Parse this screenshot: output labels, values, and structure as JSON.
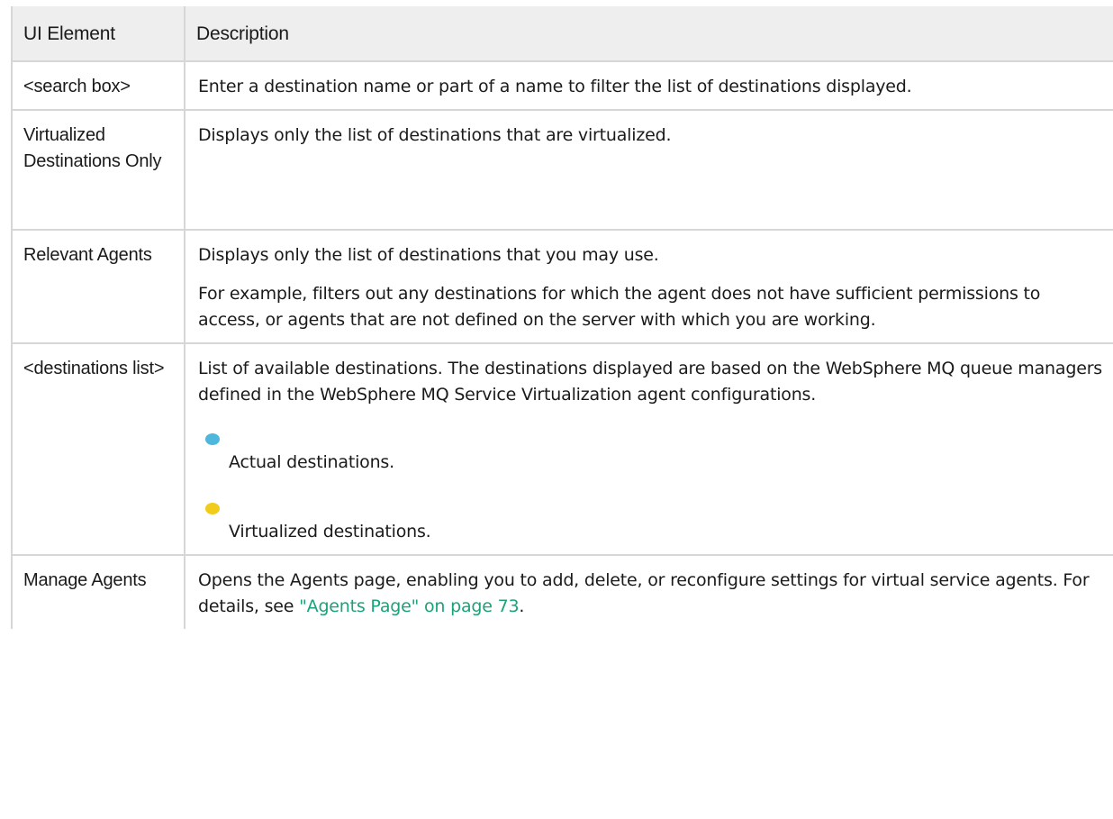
{
  "table": {
    "headers": {
      "element": "UI Element",
      "description": "Description"
    },
    "rows": [
      {
        "element": "<search box>",
        "description": "Enter a destination name or part of a name to filter the list of destinations displayed."
      },
      {
        "element": "Virtualized Destinations Only",
        "description": "Displays only the list of destinations that are virtualized."
      },
      {
        "element": "Relevant Agents",
        "paragraphs": [
          "Displays only the list of destinations that you may use.",
          "For example, filters out any destinations for which the agent does not have sufficient permissions to access, or agents that are not defined on the server with which you are working."
        ]
      },
      {
        "element": "<destinations list>",
        "description": "List of available destinations. The destinations displayed are based on the WebSphere MQ queue managers defined in the WebSphere MQ Service Virtualization agent configurations.",
        "legend": [
          {
            "icon": "blue-circle-icon",
            "color": "#4fb6dd",
            "text": "Actual destinations."
          },
          {
            "icon": "yellow-circle-icon",
            "color": "#f2cc1a",
            "text": "Virtualized destinations."
          }
        ]
      },
      {
        "element": "Manage Agents",
        "description_before_link": "Opens the Agents page, enabling you to add, delete, or reconfigure settings for virtual service agents. For details, see ",
        "link": "\"Agents Page\" on page 73",
        "description_after_link": ".",
        "link_color": "#1aa37a"
      }
    ]
  }
}
